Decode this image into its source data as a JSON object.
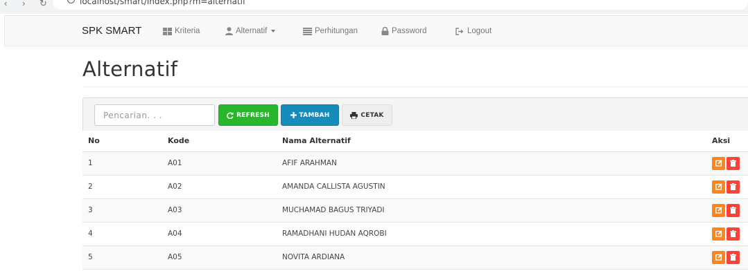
{
  "browser": {
    "url": "localhost/smart/index.php?m=alternatif",
    "back_glyph": "‹",
    "forward_glyph": "›",
    "reload_glyph": "↻"
  },
  "navbar": {
    "brand": "SPK SMART",
    "items": [
      {
        "label": "Kriteria",
        "icon": "th-large-icon"
      },
      {
        "label": "Alternatif",
        "icon": "user-icon",
        "dropdown": true
      },
      {
        "label": "Perhitungan",
        "icon": "list-icon"
      },
      {
        "label": "Password",
        "icon": "lock-icon"
      },
      {
        "label": "Logout",
        "icon": "log-out-icon"
      }
    ]
  },
  "page": {
    "title": "Alternatif"
  },
  "toolbar": {
    "search_placeholder": "Pencarian. . .",
    "search_value": "",
    "refresh_label": "REFRESH",
    "tambah_label": "TAMBAH",
    "cetak_label": "CETAK"
  },
  "table": {
    "headers": {
      "no": "No",
      "kode": "Kode",
      "nama": "Nama Alternatif",
      "aksi": "Aksi"
    },
    "rows": [
      {
        "no": "1",
        "kode": "A01",
        "nama": "AFIF ARAHMAN"
      },
      {
        "no": "2",
        "kode": "A02",
        "nama": "AMANDA CALLISTA AGUSTIN"
      },
      {
        "no": "3",
        "kode": "A03",
        "nama": "MUCHAMAD BAGUS TRIYADI"
      },
      {
        "no": "4",
        "kode": "A04",
        "nama": "RAMADHANI HUDAN AQROBI"
      },
      {
        "no": "5",
        "kode": "A05",
        "nama": "NOVITA ARDIANA"
      }
    ]
  },
  "colors": {
    "refresh": "#28b62c",
    "tambah": "#158cba",
    "edit": "#ff851b",
    "delete": "#ff4136"
  }
}
